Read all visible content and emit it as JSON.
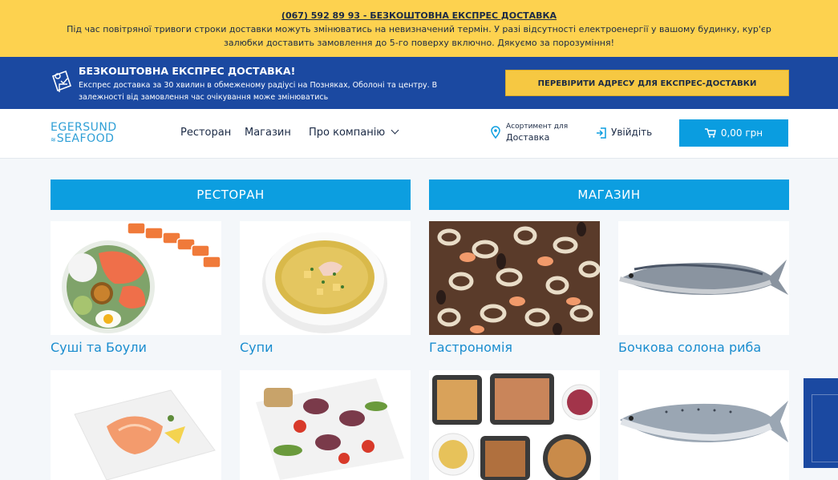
{
  "alert": {
    "phone_link": "(067) 592 89 93 - БЕЗКОШТОВНА ЕКСПРЕС ДОСТАВКА",
    "message": "Під час повітряної тривоги строки доставки можуть змінюватись на невизначений термін. У разі відсутності електроенергії у вашому будинку, кур'єр залюбки доставить замовлення до 5-го поверху включно. Дякуємо за порозуміння!"
  },
  "promo": {
    "title": "БЕЗКОШТОВНА ЕКСПРЕС ДОСТАВКА!",
    "description": "Експрес доставка за 30 хвилин в обмеженому радіусі на Позняках, Оболоні та центру. В залежності від замовлення час очікування може змінюватись",
    "button_label": "ПЕРЕВІРИТИ АДРЕСУ ДЛЯ ЕКСПРЕС-ДОСТАВКИ"
  },
  "header": {
    "logo_top": "EGERSUND",
    "logo_bottom": "SEAFOOD",
    "nav": [
      "Ресторан",
      "Магазин",
      "Про компанію"
    ],
    "assortment_label": "Асортимент для",
    "assortment_value": "Доставка",
    "login_label": "Увійдіть",
    "cart_total": "0,00 грн"
  },
  "sections": {
    "restaurant": "РЕСТОРАН",
    "shop": "МАГАЗИН"
  },
  "categories": [
    {
      "label": "Суші та Боули"
    },
    {
      "label": "Супи"
    },
    {
      "label": "Гастрономія"
    },
    {
      "label": "Бочкова солона риба"
    }
  ],
  "colors": {
    "alert_bg": "#fdd24f",
    "promo_bg": "#1b49a1",
    "accent_blue": "#0c9ee0",
    "promo_button": "#f6c842"
  }
}
